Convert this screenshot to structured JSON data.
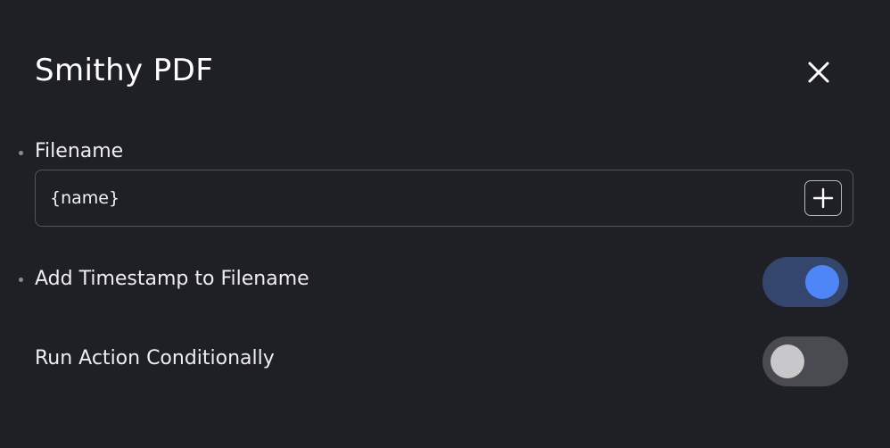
{
  "dialog": {
    "title": "Smithy PDF",
    "close_icon": "close-icon"
  },
  "filename": {
    "label": "Filename",
    "value": "{name}",
    "add_icon": "plus-icon"
  },
  "add_timestamp": {
    "label": "Add Timestamp to Filename",
    "enabled": true,
    "accent_color": "#4f86f7"
  },
  "run_conditionally": {
    "label": "Run Action Conditionally",
    "enabled": false
  }
}
